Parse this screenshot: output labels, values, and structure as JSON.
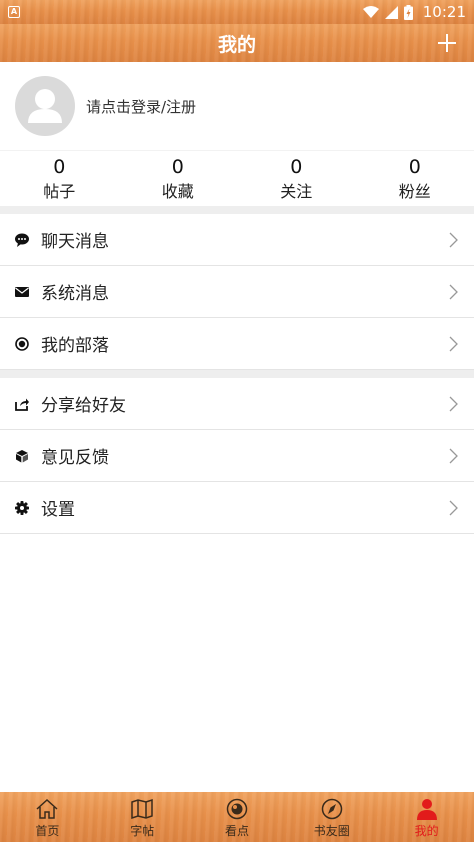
{
  "status_bar": {
    "time": "10:21"
  },
  "header": {
    "title": "我的"
  },
  "profile": {
    "login_prompt": "请点击登录/注册"
  },
  "stats": [
    {
      "value": "0",
      "label": "帖子"
    },
    {
      "value": "0",
      "label": "收藏"
    },
    {
      "value": "0",
      "label": "关注"
    },
    {
      "value": "0",
      "label": "粉丝"
    }
  ],
  "menu_group_1": [
    {
      "label": "聊天消息",
      "icon": "chat-bubble-icon"
    },
    {
      "label": "系统消息",
      "icon": "envelope-icon"
    },
    {
      "label": "我的部落",
      "icon": "target-icon"
    }
  ],
  "menu_group_2": [
    {
      "label": "分享给好友",
      "icon": "share-icon"
    },
    {
      "label": "意见反馈",
      "icon": "cube-icon"
    },
    {
      "label": "设置",
      "icon": "gear-icon"
    }
  ],
  "tab_bar": {
    "active_index": 4,
    "active_color": "#e21b1b",
    "items": [
      {
        "label": "首页",
        "icon": "home-icon"
      },
      {
        "label": "字帖",
        "icon": "map-icon"
      },
      {
        "label": "看点",
        "icon": "eye-circle-icon"
      },
      {
        "label": "书友圈",
        "icon": "compass-icon"
      },
      {
        "label": "我的",
        "icon": "person-icon"
      }
    ]
  }
}
